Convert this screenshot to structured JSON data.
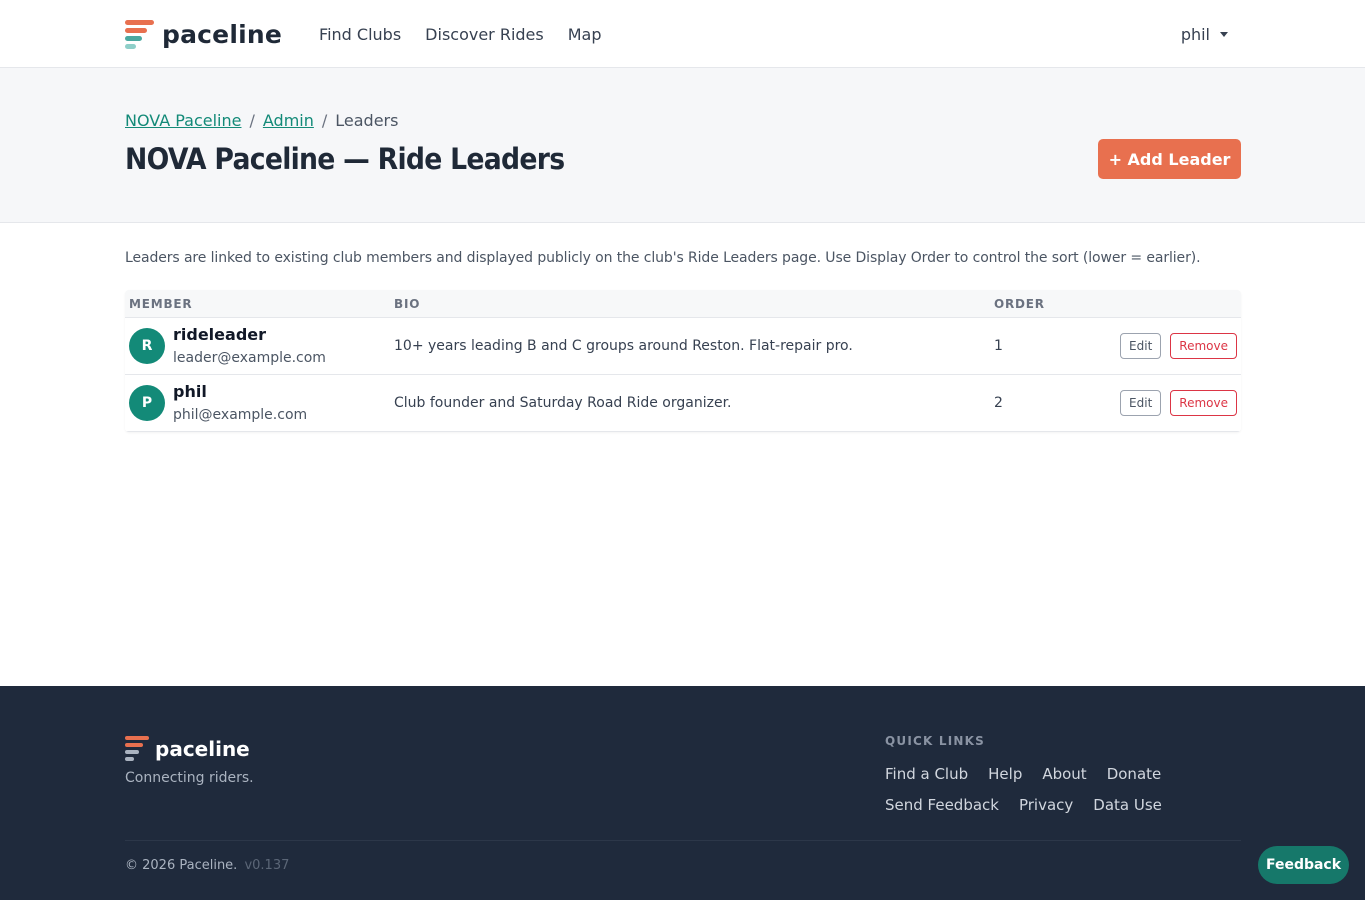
{
  "brand": {
    "name": "paceline",
    "logo_colors": [
      "#e8704f",
      "#e8704f",
      "#4aa8a0",
      "#4aa8a0"
    ]
  },
  "nav": {
    "links": [
      "Find Clubs",
      "Discover Rides",
      "Map"
    ],
    "user": "phil"
  },
  "breadcrumb": {
    "items": [
      "NOVA Paceline",
      "Admin"
    ],
    "separator": "/",
    "current": "Leaders"
  },
  "header": {
    "title": "NOVA Paceline — Ride Leaders",
    "add_button": "+ Add Leader"
  },
  "intro": "Leaders are linked to existing club members and displayed publicly on the club's Ride Leaders page. Use Display Order to control the sort (lower = earlier).",
  "table": {
    "columns": [
      "MEMBER",
      "BIO",
      "ORDER"
    ],
    "rows": [
      {
        "initial": "R",
        "name": "rideleader",
        "email": "leader@example.com",
        "bio": "10+ years leading B and C groups around Reston. Flat-repair pro.",
        "order": "1",
        "edit": "Edit",
        "remove": "Remove"
      },
      {
        "initial": "P",
        "name": "phil",
        "email": "phil@example.com",
        "bio": "Club founder and Saturday Road Ride organizer.",
        "order": "2",
        "edit": "Edit",
        "remove": "Remove"
      }
    ]
  },
  "footer": {
    "brand": "paceline",
    "tagline": "Connecting riders.",
    "quick_links_title": "QUICK LINKS",
    "quick_links": [
      "Find a Club",
      "Help",
      "About",
      "Donate",
      "Send Feedback",
      "Privacy",
      "Data Use"
    ],
    "copyright": "© 2026 Paceline.",
    "version": "v0.137"
  },
  "feedback_button": "Feedback",
  "colors": {
    "accent": "#e8704f",
    "teal": "#138a78",
    "danger": "#dc3545",
    "footer_bg": "#1f2a3c"
  }
}
